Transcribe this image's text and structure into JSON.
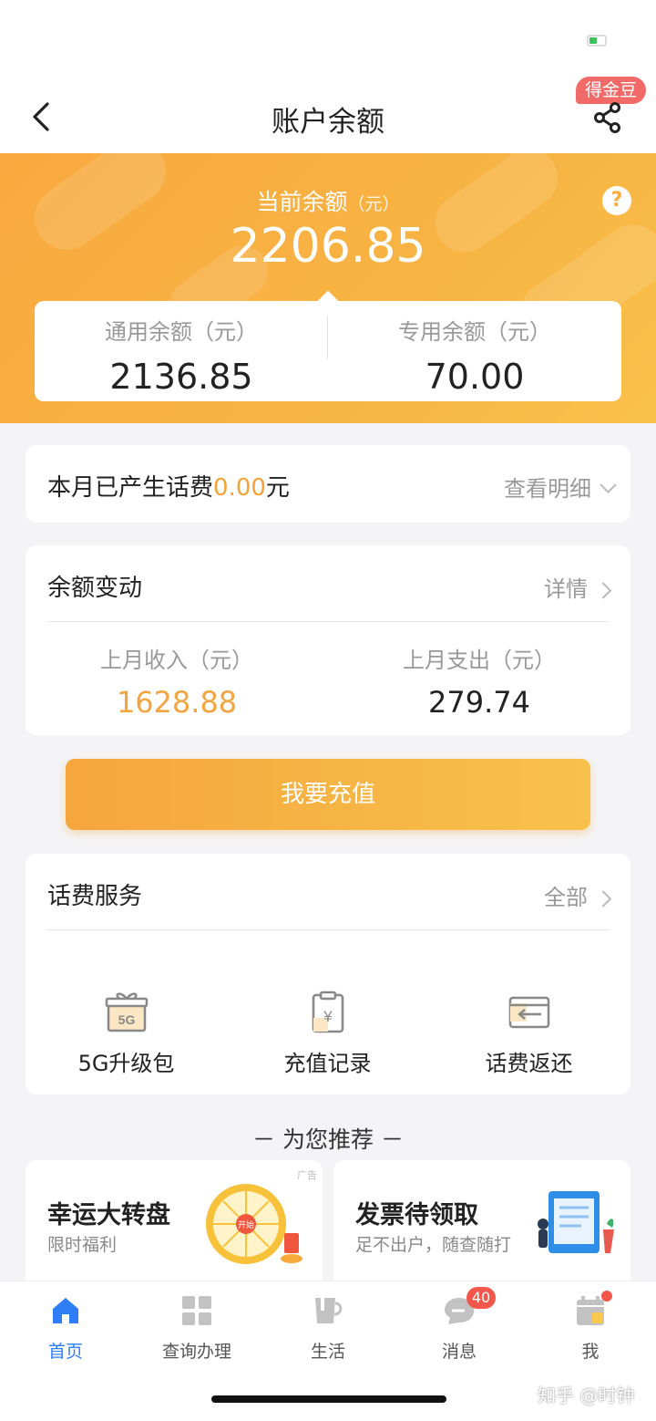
{
  "nav": {
    "title": "账户余额",
    "gold_badge": "得金豆"
  },
  "balance": {
    "label": "当前余额",
    "unit": "（元）",
    "value": "2206.85",
    "general_label": "通用余额（元）",
    "general_value": "2136.85",
    "special_label": "专用余额（元）",
    "special_value": "70.00"
  },
  "fee": {
    "prefix": "本月已产生话费",
    "amount": "0.00",
    "suffix": "元",
    "link": "查看明细"
  },
  "changes": {
    "title": "余额变动",
    "link": "详情",
    "income_label": "上月收入（元）",
    "income_value": "1628.88",
    "expense_label": "上月支出（元）",
    "expense_value": "279.74"
  },
  "recharge_button": "我要充值",
  "services": {
    "title": "话费服务",
    "link": "全部",
    "items": [
      {
        "label": "5G升级包",
        "icon": "gift-5g-icon"
      },
      {
        "label": "充值记录",
        "icon": "recharge-record-icon"
      },
      {
        "label": "话费返还",
        "icon": "refund-icon"
      }
    ]
  },
  "recommend": {
    "title": "－ 为您推荐 －",
    "promos": [
      {
        "title": "幸运大转盘",
        "subtitle": "限时福利",
        "ad": "广告",
        "wheel_text": "开始"
      },
      {
        "title": "发票待领取",
        "subtitle": "足不出户，随查随打"
      }
    ]
  },
  "tabs": [
    {
      "label": "首页",
      "icon": "home-icon",
      "active": true
    },
    {
      "label": "查询办理",
      "icon": "grid-icon"
    },
    {
      "label": "生活",
      "icon": "cup-icon"
    },
    {
      "label": "消息",
      "icon": "chat-icon",
      "badge": "40"
    },
    {
      "label": "我",
      "icon": "profile-icon",
      "dot": true
    }
  ],
  "watermark": "知乎 @时钟",
  "colors": {
    "accent_orange": "#f7ad42",
    "active_blue": "#2e7cf6",
    "badge_red": "#f3564a"
  }
}
